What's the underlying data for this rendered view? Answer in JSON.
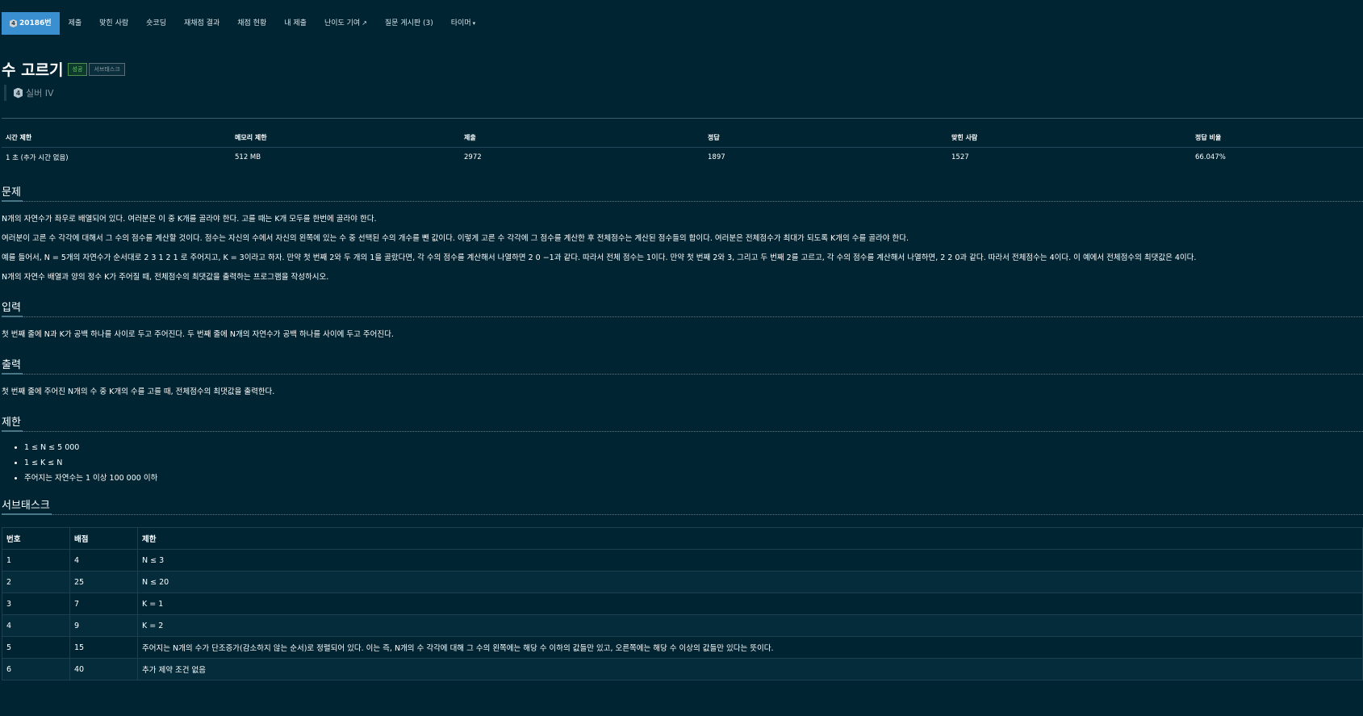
{
  "nav": {
    "problem_number": "20186번",
    "items": [
      "제출",
      "맞힌 사람",
      "숏코딩",
      "재채점 결과",
      "채점 현황",
      "내 제출",
      "난이도 기여",
      "질문 게시판 (3)",
      "타이머"
    ]
  },
  "title": "수 고르기",
  "labels": {
    "success": "성공",
    "subtask": "서브태스크"
  },
  "tier": {
    "badge": "4",
    "name": "실버 IV"
  },
  "info": {
    "headers": [
      "시간 제한",
      "메모리 제한",
      "제출",
      "정답",
      "맞힌 사람",
      "정답 비율"
    ],
    "values": [
      "1 초 (추가 시간 없음)",
      "512 MB",
      "2972",
      "1897",
      "1527",
      "66.047%"
    ]
  },
  "sections": {
    "problem": {
      "title": "문제",
      "paragraphs": [
        "N개의 자연수가 좌우로 배열되어 있다. 여러분은 이 중 K개를 골라야 한다. 고를 때는 K개 모두를 한번에 골라야 한다.",
        "여러분이 고른 수 각각에 대해서 그 수의 점수를 계산할 것이다. 점수는 자신의 수에서 자신의 왼쪽에 있는 수 중 선택된 수의 개수를 뺀 값이다. 이렇게 고른 수 각각에 그 점수를 계산한 후 전체점수는 계산된 점수들의 합이다. 여러분은 전체점수가 최대가 되도록 K개의 수를 골라야 한다.",
        "예를 들어서, N = 5개의 자연수가 순서대로 2 3 1 2 1 로 주어지고, K = 3이라고 하자. 만약 첫 번째 2와 두 개의 1을 골랐다면, 각 수의 점수를 계산해서 나열하면 2 0 −1과 같다. 따라서 전체 점수는 1이다. 만약 첫 번째 2와 3, 그리고 두 번째 2를 고르고, 각 수의 점수를 계산해서 나열하면, 2 2 0과 같다. 따라서 전체점수는 4이다. 이 예에서 전체점수의 최댓값은 4이다.",
        "N개의 자연수 배열과 양의 정수 K가 주어질 때, 전체점수의 최댓값을 출력하는 프로그램을 작성하시오."
      ]
    },
    "input": {
      "title": "입력",
      "text": "첫 번째 줄에 N과 K가 공백 하나를 사이로 두고 주어진다. 두 번째 줄에 N개의 자연수가 공백 하나를 사이에 두고 주어진다."
    },
    "output": {
      "title": "출력",
      "text": "첫 번째 줄에 주어진 N개의 수 중 K개의 수를 고를 때, 전체점수의 최댓값을 출력한다."
    },
    "limits": {
      "title": "제한",
      "items": [
        "1 ≤ N ≤ 5 000",
        "1 ≤ K ≤ N",
        "주어지는 자연수는 1 이상 100 000 이하"
      ]
    },
    "subtasks": {
      "title": "서브태스크",
      "headers": [
        "번호",
        "배점",
        "제한"
      ],
      "rows": [
        [
          "1",
          "4",
          "N ≤ 3"
        ],
        [
          "2",
          "25",
          "N ≤ 20"
        ],
        [
          "3",
          "7",
          "K = 1"
        ],
        [
          "4",
          "9",
          "K = 2"
        ],
        [
          "5",
          "15",
          "주어지는 N개의 수가 단조증가(감소하지 않는 순서)로 정렬되어 있다. 이는 즉, N개의 수 각각에 대해 그 수의 왼쪽에는 해당 수 이하의 값들만 있고, 오른쪽에는 해당 수 이상의 값들만 있다는 뜻이다."
        ],
        [
          "6",
          "40",
          "추가 제약 조건 없음"
        ]
      ]
    }
  }
}
